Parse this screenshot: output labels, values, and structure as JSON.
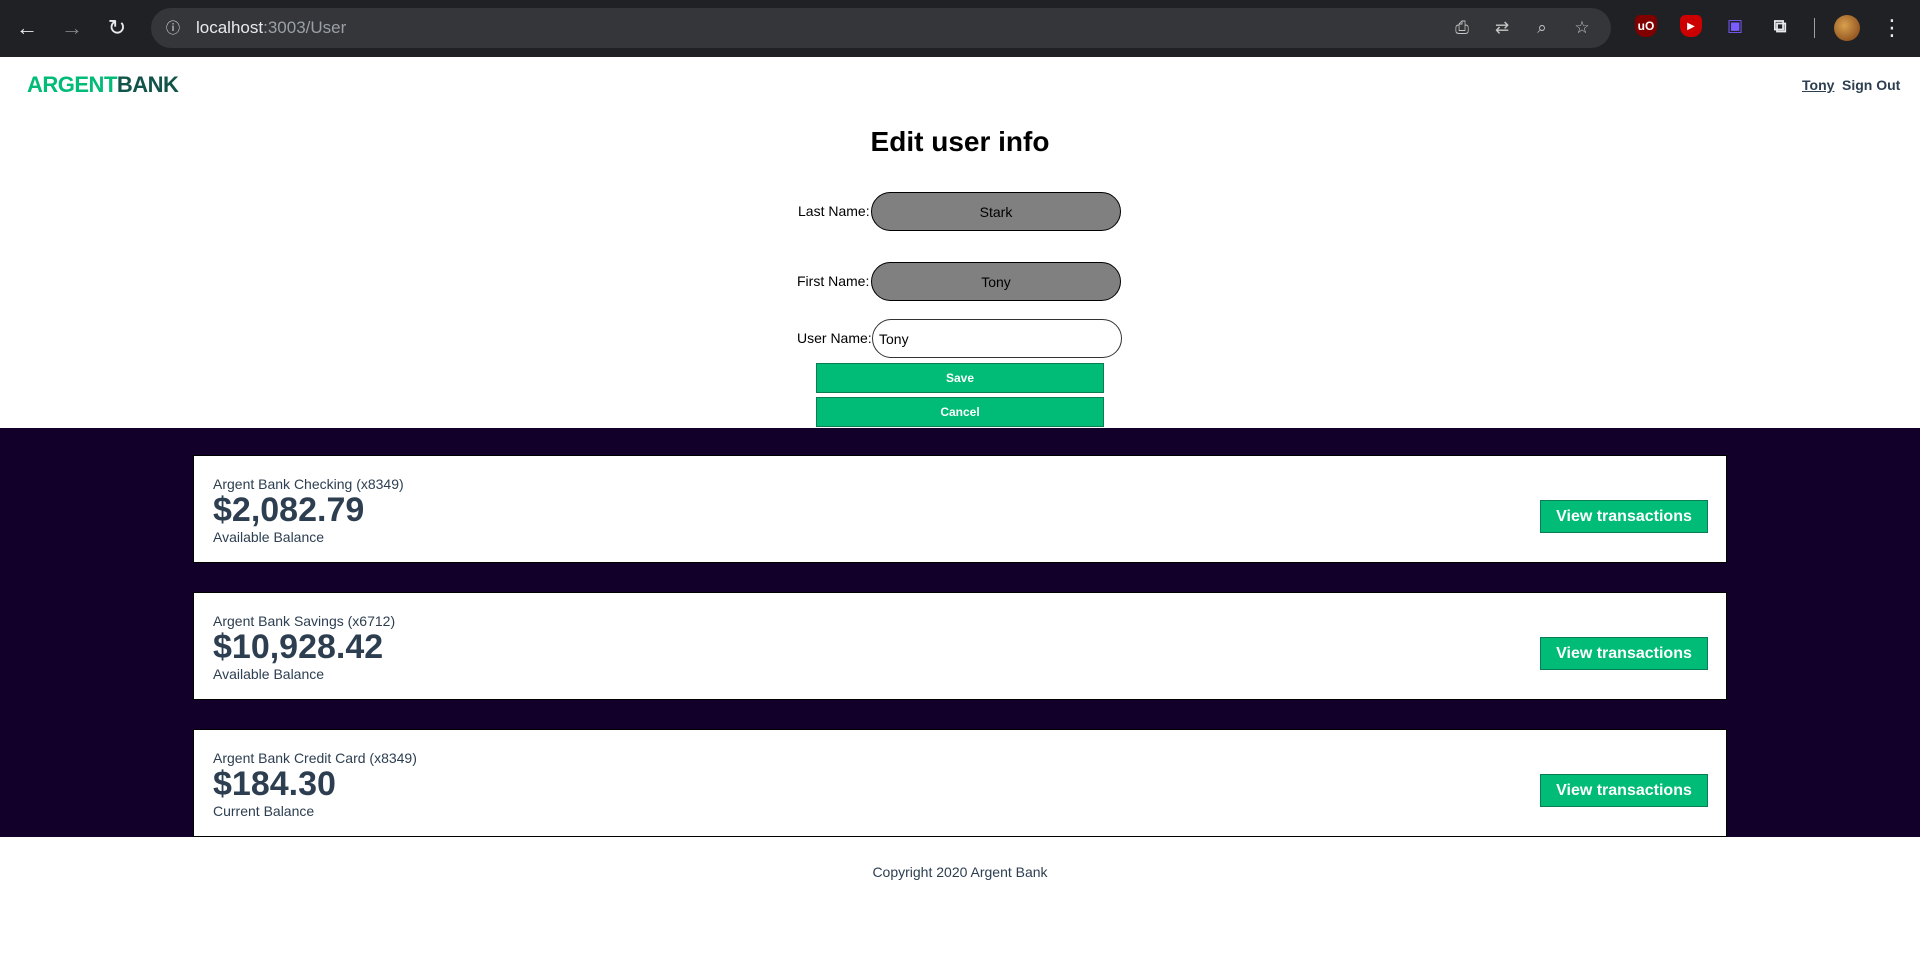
{
  "browser": {
    "url_host": "localhost",
    "url_path": ":3003/User"
  },
  "header": {
    "logo_part1": "ARGENT",
    "logo_part2": "BANK",
    "user_link": "Tony",
    "signout_label": "Sign Out"
  },
  "edit_form": {
    "title": "Edit user info",
    "last_name_label": "Last Name:",
    "last_name_value": "Stark",
    "first_name_label": "First Name:",
    "first_name_value": "Tony",
    "user_name_label": "User Name:",
    "user_name_value": "Tony",
    "save_label": "Save",
    "cancel_label": "Cancel"
  },
  "accounts": [
    {
      "title": "Argent Bank Checking (x8349)",
      "amount": "$2,082.79",
      "description": "Available Balance",
      "button": "View transactions"
    },
    {
      "title": "Argent Bank Savings (x6712)",
      "amount": "$10,928.42",
      "description": "Available Balance",
      "button": "View transactions"
    },
    {
      "title": "Argent Bank Credit Card (x8349)",
      "amount": "$184.30",
      "description": "Current Balance",
      "button": "View transactions"
    }
  ],
  "footer": {
    "copyright": "Copyright 2020 Argent Bank"
  },
  "colors": {
    "accent": "#00bc77",
    "accounts_background": "#12002b",
    "text": "#2c3e50"
  }
}
